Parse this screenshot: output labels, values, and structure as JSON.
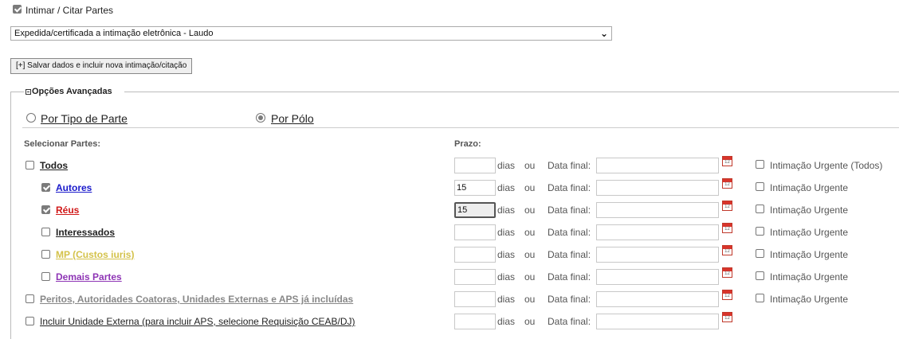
{
  "intimar": {
    "label": "Intimar / Citar Partes",
    "checked": true
  },
  "tipo_select": {
    "value": "Expedida/certificada a intimação eletrônica - Laudo"
  },
  "salvar_button": {
    "label": "[+] Salvar dados e incluir nova intimação/citação"
  },
  "opcoes": {
    "legend": "Opções Avançadas",
    "radio_tipo_parte": "Por Tipo de Parte",
    "radio_por_polo": "Por Pólo",
    "selected": "Por Pólo"
  },
  "headers": {
    "selecionar_partes": "Selecionar Partes:",
    "prazo": "Prazo:"
  },
  "common": {
    "dias": "dias",
    "ou": "ou",
    "data_final": "Data final:",
    "cal_day": "12"
  },
  "colors": {
    "autores": "#1a1acb",
    "reus": "#d01818",
    "interessados": "#222222",
    "mp": "#d4c24a",
    "demais": "#8e35b5",
    "peritos": "#888888"
  },
  "rows": [
    {
      "label": "Todos",
      "checked": false,
      "days": "",
      "urgent": "Intimação Urgente (Todos)"
    },
    {
      "label": "Autores",
      "checked": true,
      "days": "15",
      "urgent": "Intimação Urgente"
    },
    {
      "label": "Réus",
      "checked": true,
      "days": "15",
      "urgent": "Intimação Urgente"
    },
    {
      "label": "Interessados",
      "checked": false,
      "days": "",
      "urgent": "Intimação Urgente"
    },
    {
      "label": "MP (Custos iuris)",
      "checked": false,
      "days": "",
      "urgent": "Intimação Urgente"
    },
    {
      "label": "Demais Partes",
      "checked": false,
      "days": "",
      "urgent": "Intimação Urgente"
    },
    {
      "label": "Peritos, Autoridades Coatoras, Unidades Externas e APS já incluídas",
      "checked": false,
      "days": "",
      "urgent": "Intimação Urgente"
    },
    {
      "label": "Incluir Unidade Externa (para incluir APS, selecione Requisição CEAB/DJ)",
      "checked": false,
      "days": "",
      "urgent": ""
    }
  ]
}
